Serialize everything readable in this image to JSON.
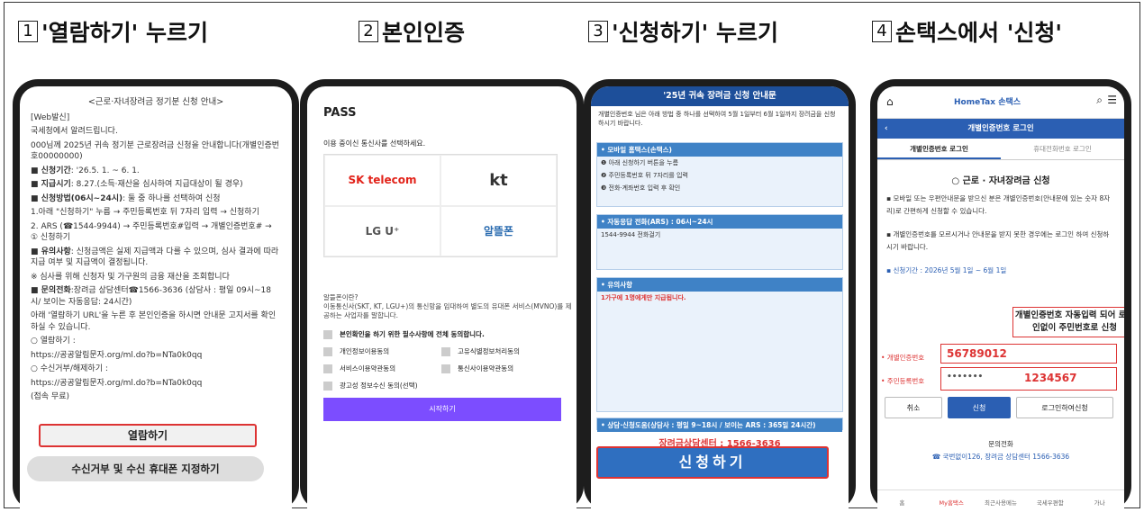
{
  "steps": [
    {
      "num": "1",
      "title": "'열람하기' 누르기"
    },
    {
      "num": "2",
      "title": "본인인증"
    },
    {
      "num": "3",
      "title": "'신청하기' 누르기"
    },
    {
      "num": "4",
      "title": "손택스에서 '신청'"
    }
  ],
  "phone1": {
    "title": "<근로·자녀장려금 정기분 신청 안내>",
    "lines": [
      "[Web발신]",
      "국세청에서 알려드립니다.",
      "000님께 2025년 귀속 정기분 근로장려금 신청을 안내합니다(개별인증번호00000000)"
    ],
    "period_label": "■ 신청기간",
    "period": ": '26.5. 1. ~ 6. 1.",
    "pay_label": "■ 지급시기",
    "pay": ": 8.27.(소득·재산을 심사하여 지급대상이 될 경우)",
    "method_label": "■ 신청방법(06시~24시)",
    "method": ": 둘 중 하나를 선택하여 신청",
    "m1": "1.아래 \"신청하기\" 누름 → 주민등록번호 뒤 7자리 입력 → 신청하기",
    "m2": "2. ARS (☎1544-9944) → 주민등록번호#입력 → 개별인증번호# → ① 신청하기",
    "note_label": "■ 유의사항",
    "note": ": 신청금액은 실제 지급액과 다를 수 있으며, 심사 결과에 따라 지급 여부 및 지급액이 결정됩니다.",
    "note2": "※ 심사를 위해 신청자 및 가구원의 금융 재산을 조회합니다",
    "inq_label": "■ 문의전화",
    "inq": ":장려금 상담센터☎1566-3636 (상담사 : 평일 09시~18시/ 보이는 자동응답: 24시간)",
    "guide": "아래 '열람하기 URL'을 누른 후 본인인증을 하시면 안내문 고지서를 확인하실 수 있습니다.",
    "view_label": "○ 열람하기 :",
    "view_url": "https://공공알림문자.org/ml.do?b=NTa0k0qq",
    "reject_label": "○ 수신거부/해제하기 :",
    "reject_url": "https://공공알림문자.org/ml.do?b=NTa0k0qq",
    "free": "(접속 무료)",
    "btn_view": "열람하기",
    "btn_reject": "수신거부 및 수신 휴대폰 지정하기"
  },
  "phone2": {
    "brand": "PASS",
    "prompt": "이용 중이신 통신사를 선택하세요.",
    "carriers": [
      "SK telecom",
      "kt",
      "LG U⁺",
      "알뜰폰"
    ],
    "alt_title": "알뜰폰이란?",
    "alt_desc": "이동통신사(SKT, KT, LGU+)의 통신망을 임대하여 별도의 유대폰 서비스(MVNO)를 제공하는 사업자를 말합니다.",
    "agree_all": "본인확인을 하기 위한 필수사항에 전체 동의합니다.",
    "agrees": [
      "개인정보이용동의",
      "고유식별정보처리동의",
      "서비스이용약관동의",
      "통신사이용약관동의",
      "광고성 정보수신 동의(선택)"
    ],
    "start": "시작하기"
  },
  "phone3": {
    "header": "'25년 귀속          장려금 신청 안내문",
    "intro": "개별인증번호 님은 아래 방법 중 하나를 선택하여 5월 1일부터 6월 1일까지 장려금을 신청 하시기 바랍니다.",
    "s1": "• 모바일 홈택스(손택스)",
    "s1a": "❶ 아래 신청하기 버튼을 누름",
    "s1b": "❷ 주민등록번호 뒤 7자리를 입력",
    "s1c": "❸ 전화·계좌번호 입력 후 확인",
    "s2": "• 자동응답 전화(ARS) : 06시~24시",
    "s2a": "1544-9944 전화걸기",
    "s3": "• 유의사항",
    "s3a": "1가구에 1명에게만 지급됩니다.",
    "s4": "• 상담·신청도움(상담사 : 평일 9~18시 / 보이는 ARS : 365일 24시간)",
    "center": "장려금상담센터 : 1566-3636",
    "apply": "신청하기"
  },
  "phone4": {
    "logo": "HomeTax 손택스",
    "bar": "개별인증번호 로그인",
    "tab1": "개별인증번호 로그인",
    "tab2": "휴대전화번호 로그인",
    "title": "○ 근로 · 자녀장려금 신청",
    "t1": "▪ 모바일 또는 우편안내문을 받으신 분은 개별인증번호(안내문에 있는 숫자 8자리)로 간편하게 신청할 수 있습니다.",
    "t2": "▪ 개별인증번호를 모르시거나 안내문을 받지 못한 경우에는 로그인 하여 신청하시기 바랍니다.",
    "period": "▪ 신청기간 : 2026년 5월 1일 ~ 6월 1일",
    "callout": "개별인증번호 자동입력 되어 로그인없이 주민번호로 신청",
    "auth_label": "• 개별인증번호",
    "auth": "56789012",
    "rrn_label": "• 주민등록번호",
    "rrn_mask": "•••••••",
    "rrn": "1234567",
    "cancel": "취소",
    "apply": "신청",
    "login": "로그인하여신청",
    "inquiry": "문의전화",
    "phone": "☎ 국번없이126, 장려금 상담센터 1566-3636",
    "nav": [
      "홈",
      "My홈택스",
      "최근사용메뉴",
      "국세우편함",
      "가나"
    ]
  },
  "colors": {
    "red": "#d33333",
    "blue": "#2f6fc0",
    "purple": "#7c4dff"
  }
}
